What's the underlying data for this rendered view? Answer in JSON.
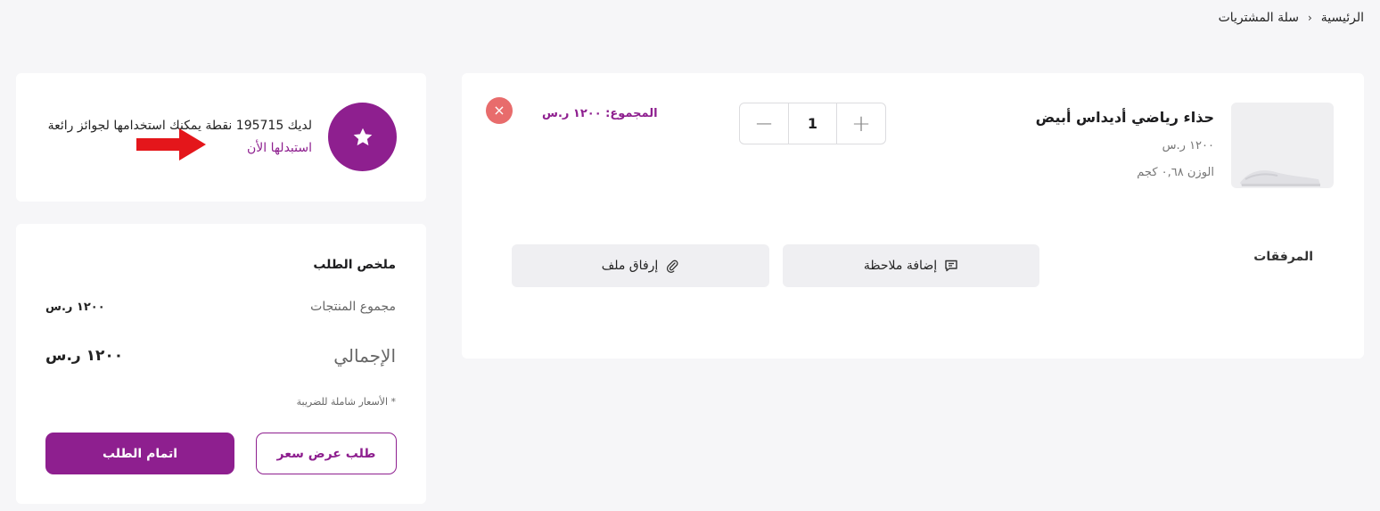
{
  "breadcrumb": {
    "home": "الرئيسية",
    "separator": "›",
    "current": "سلة المشتريات"
  },
  "cart": {
    "item": {
      "name": "حذاء رياضي أديداس أبيض",
      "price": "١٢٠٠ ر.س",
      "weight": "الوزن ٠,٦٨ كجم",
      "image_icon": "shoe-image"
    },
    "quantity": {
      "value": "1",
      "plus": "+",
      "minus": "−"
    },
    "total": "المجموع: ١٢٠٠ ر.س",
    "remove_icon": "×",
    "attachments_label": "المرفقات",
    "add_note": "إضافة ملاحظة",
    "attach_file": "إرفاق ملف"
  },
  "points": {
    "message": "لديك 195715 نقطة يمكنك استخدامها لجوائز رائعة",
    "redeem_link": "استبدلها الأن"
  },
  "summary": {
    "title": "ملخص الطلب",
    "subtotal_label": "مجموع المنتجات",
    "subtotal_value": "١٢٠٠ ر.س",
    "total_label": "الإجمالي",
    "total_value": "١٢٠٠ ر.س",
    "tax_note": "* الأسعار شاملة للضريبة",
    "checkout_button": "اتمام الطلب",
    "quote_button": "طلب عرض سعر"
  },
  "colors": {
    "accent": "#8e1f8f",
    "danger": "#e86c6c",
    "arrow": "#e4161b"
  }
}
